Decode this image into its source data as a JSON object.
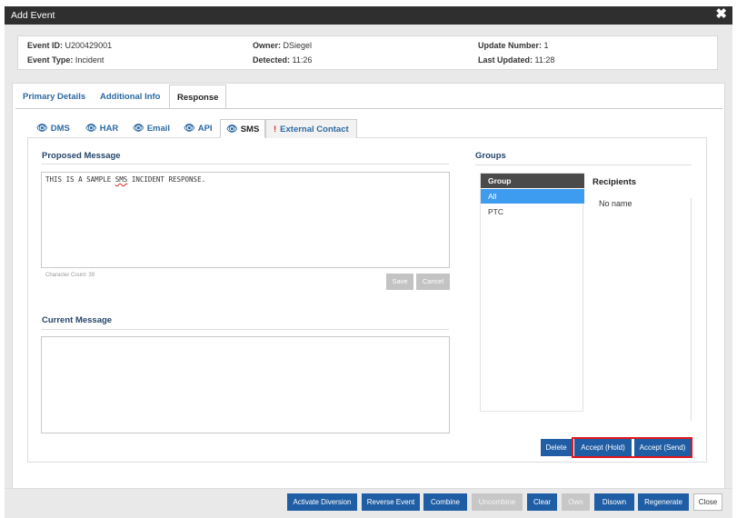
{
  "window": {
    "title": "Add Event",
    "close_glyph": "✖"
  },
  "info": {
    "event_id_label": "Event ID:",
    "event_id": "U200429001",
    "event_type_label": "Event Type:",
    "event_type": "Incident",
    "owner_label": "Owner:",
    "owner": "DSiegel",
    "detected_label": "Detected:",
    "detected": "11:26",
    "update_number_label": "Update Number:",
    "update_number": "1",
    "last_updated_label": "Last Updated:",
    "last_updated": "11:28"
  },
  "tabs": [
    {
      "label": "Primary Details"
    },
    {
      "label": "Additional Info"
    },
    {
      "label": "Response",
      "active": true
    }
  ],
  "subtabs": [
    {
      "label": "DMS",
      "icon": "eye-icon"
    },
    {
      "label": "HAR",
      "icon": "eye-icon"
    },
    {
      "label": "Email",
      "icon": "eye-icon"
    },
    {
      "label": "API",
      "icon": "eye-icon"
    },
    {
      "label": "SMS",
      "icon": "eye-icon",
      "active": true
    },
    {
      "label": "External Contact",
      "icon": "exclamation-icon"
    }
  ],
  "proposed": {
    "title": "Proposed Message",
    "text_before": "THIS IS A SAMPLE ",
    "text_spell": "SMS",
    "text_after": " INCIDENT RESPONSE.",
    "char_count": "Character Count: 39",
    "save_label": "Save",
    "cancel_label": "Cancel"
  },
  "current": {
    "title": "Current Message",
    "text": ""
  },
  "groups": {
    "title": "Groups",
    "column": "Group",
    "rows": [
      {
        "name": "All",
        "selected": true
      },
      {
        "name": "PTC"
      }
    ],
    "recipients_title": "Recipients",
    "recipients_value": "No name"
  },
  "actions": {
    "delete": "Delete",
    "accept_hold": "Accept (Hold)",
    "accept_send": "Accept (Send)"
  },
  "footer": {
    "activate_diversion": "Activate Diversion",
    "reverse_event": "Reverse Event",
    "combine": "Combine",
    "uncombine": "Uncombine",
    "clear": "Clear",
    "own": "Own",
    "disown": "Disown",
    "regenerate": "Regenerate",
    "close": "Close"
  },
  "colors": {
    "accent": "#1f5da5",
    "link": "#2d69a3",
    "highlight": "#e3161b",
    "selected_row": "#3d9bf0"
  }
}
